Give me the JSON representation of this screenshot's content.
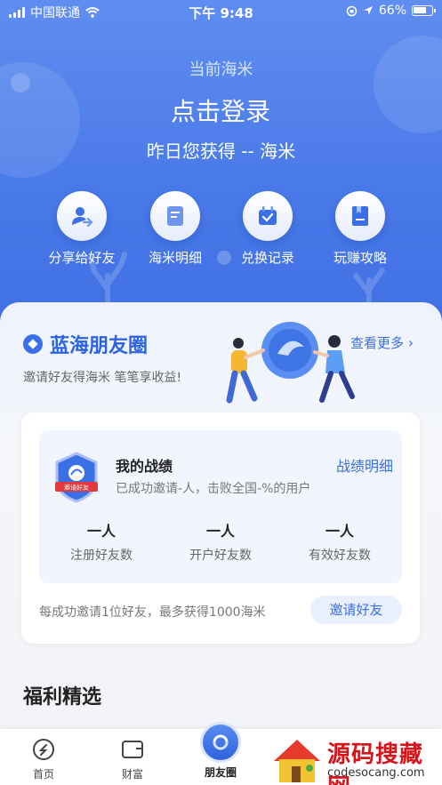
{
  "status_bar": {
    "carrier": "中国联通",
    "time": "下午 9:48",
    "battery": "66%"
  },
  "header": {
    "points_label": "当前海米",
    "login": "点击登录",
    "yesterday": "昨日您获得 -- 海米",
    "quick_actions": [
      {
        "label": "分享给好友",
        "icon": "share-user-icon"
      },
      {
        "label": "海米明细",
        "icon": "receipt-icon"
      },
      {
        "label": "兑换记录",
        "icon": "gift-calendar-icon"
      },
      {
        "label": "玩赚攻略",
        "icon": "guide-book-icon"
      }
    ]
  },
  "friends": {
    "title": "蓝海朋友圈",
    "subtitle": "邀请好友得海米 笔笔享收益!",
    "see_more": "查看更多",
    "record": {
      "badge_text": "邀请好友",
      "title": "我的战绩",
      "detail_link": "战绩明细",
      "desc": "已成功邀请-人，击败全国-%的用户",
      "stats": [
        {
          "value": "一人",
          "label": "注册好友数"
        },
        {
          "value": "一人",
          "label": "开户好友数"
        },
        {
          "value": "一人",
          "label": "有效好友数"
        }
      ]
    },
    "reward_note": "每成功邀请1位好友，最多获得1000海米",
    "invite_button": "邀请好友"
  },
  "section": {
    "title": "福利精选"
  },
  "tabbar": {
    "tabs": [
      {
        "label": "首页",
        "icon": "home-s-icon"
      },
      {
        "label": "财富",
        "icon": "wallet-icon"
      },
      {
        "label": "朋友圈",
        "icon": "friends-circle-icon"
      }
    ]
  },
  "watermark": {
    "title": "源码搜藏网",
    "url": "codesocang.com"
  },
  "colors": {
    "primary": "#3a6fe6",
    "header_top": "#5f8df0",
    "header_bottom": "#3f6fe2",
    "watermark_red": "#d4161c"
  }
}
